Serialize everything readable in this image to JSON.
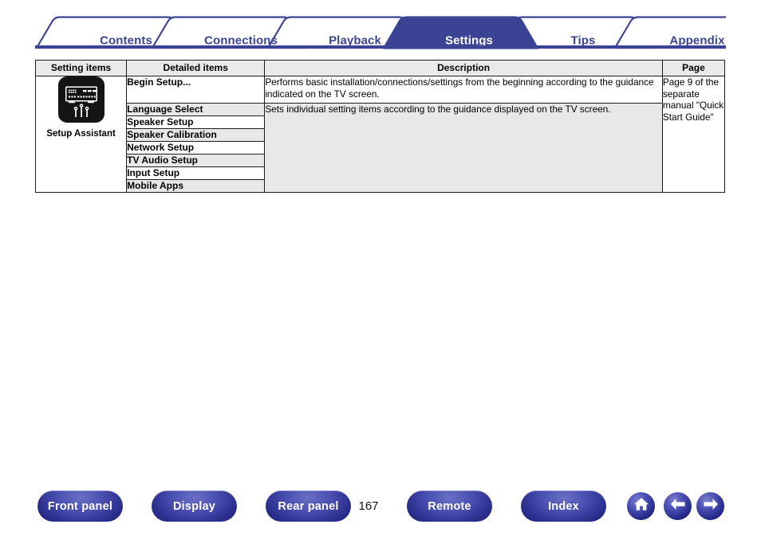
{
  "tabs": [
    {
      "label": "Contents",
      "active": false
    },
    {
      "label": "Connections",
      "active": false
    },
    {
      "label": "Playback",
      "active": false
    },
    {
      "label": "Settings",
      "active": true
    },
    {
      "label": "Tips",
      "active": false
    },
    {
      "label": "Appendix",
      "active": false
    }
  ],
  "table": {
    "headers": {
      "setting_items": "Setting items",
      "detailed_items": "Detailed items",
      "description": "Description",
      "page": "Page"
    },
    "setting_group": {
      "icon": "av-receiver-setup-assistant-icon",
      "caption": "Setup Assistant"
    },
    "rows": [
      {
        "detail": "Begin Setup..."
      },
      {
        "detail": "Language Select"
      },
      {
        "detail": "Speaker Setup"
      },
      {
        "detail": "Speaker Calibration"
      },
      {
        "detail": "Network Setup"
      },
      {
        "detail": "TV Audio Setup"
      },
      {
        "detail": "Input Setup"
      },
      {
        "detail": "Mobile Apps"
      }
    ],
    "descriptions": {
      "begin_setup": "Performs basic installation/connections/settings from the beginning according to the guidance indicated on the TV screen.",
      "individual_items": "Sets individual setting items according to the guidance displayed on the TV screen."
    },
    "page_reference": "Page 9 of the separate manual \"Quick Start Guide\""
  },
  "bottom_nav": {
    "buttons": [
      {
        "label": "Front panel"
      },
      {
        "label": "Display"
      },
      {
        "label": "Rear panel"
      },
      {
        "label": "Remote"
      },
      {
        "label": "Index"
      }
    ],
    "page_number": "167",
    "icons": [
      {
        "name": "home-icon"
      },
      {
        "name": "arrow-left-icon"
      },
      {
        "name": "arrow-right-icon"
      }
    ]
  },
  "colors": {
    "brand_blue": "#3b4395",
    "tab_active_fill": "#3b4395",
    "header_fill": "#eaeaea",
    "row_shade": "#e8e8e8"
  }
}
